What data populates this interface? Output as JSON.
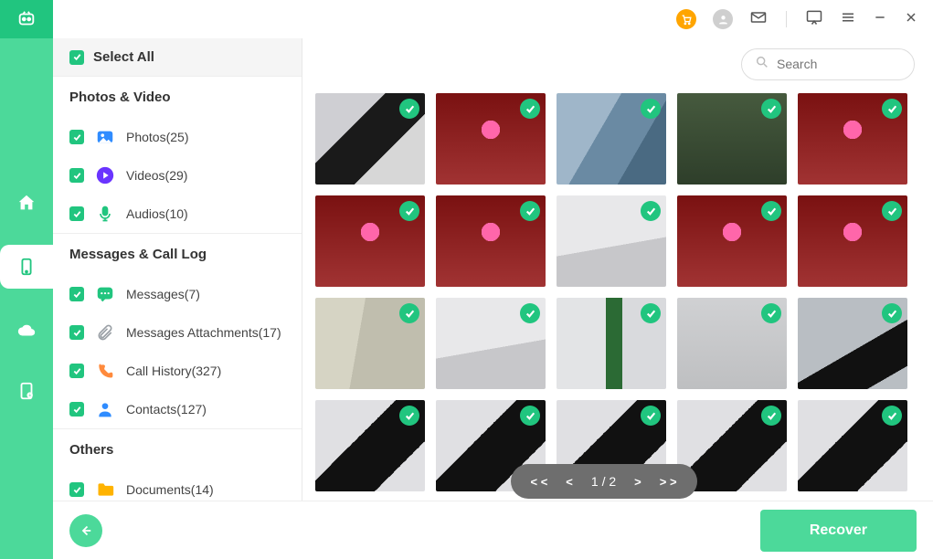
{
  "topbar": {
    "cart_icon": "cart-icon",
    "profile_icon": "profile-icon",
    "mail_icon": "mail-icon",
    "feedback_icon": "feedback-icon",
    "menu_icon": "menu-icon",
    "minimize_icon": "minimize-icon",
    "close_icon": "close-icon"
  },
  "rail": {
    "items": [
      "home-icon",
      "phone-icon",
      "cloud-icon",
      "sim-icon"
    ],
    "active_index": 1
  },
  "sidebar": {
    "select_all_label": "Select All",
    "sections": [
      {
        "header": "Photos & Video",
        "items": [
          {
            "icon": "photo-icon",
            "icon_color": "#2f8cff",
            "label": "Photos(25)"
          },
          {
            "icon": "video-icon",
            "icon_color": "#6a34ff",
            "label": "Videos(29)"
          },
          {
            "icon": "audio-icon",
            "icon_color": "#21c57f",
            "label": "Audios(10)"
          }
        ]
      },
      {
        "header": "Messages & Call Log",
        "items": [
          {
            "icon": "message-icon",
            "icon_color": "#21c57f",
            "label": "Messages(7)"
          },
          {
            "icon": "attachment-icon",
            "icon_color": "#9aa0a6",
            "label": "Messages Attachments(17)"
          },
          {
            "icon": "call-icon",
            "icon_color": "#ff8a3c",
            "label": "Call History(327)"
          },
          {
            "icon": "contacts-icon",
            "icon_color": "#2f8cff",
            "label": "Contacts(127)"
          }
        ]
      },
      {
        "header": "Others",
        "items": [
          {
            "icon": "folder-icon",
            "icon_color": "#ffb300",
            "label": "Documents(14)"
          }
        ]
      }
    ]
  },
  "search": {
    "placeholder": "Search",
    "value": ""
  },
  "gallery": {
    "thumbs": [
      "bg-a",
      "bg-b",
      "bg-c",
      "bg-d",
      "bg-b",
      "bg-b",
      "bg-b",
      "bg-e",
      "bg-b",
      "bg-b",
      "bg-f",
      "bg-e",
      "bg-g",
      "bg-i",
      "bg-j",
      "bg-h",
      "bg-h",
      "bg-h",
      "bg-h",
      "bg-h"
    ]
  },
  "pager": {
    "first": "< <",
    "prev": "<",
    "label": "1 / 2",
    "next": ">",
    "last": "> >"
  },
  "footer": {
    "recover_label": "Recover"
  }
}
